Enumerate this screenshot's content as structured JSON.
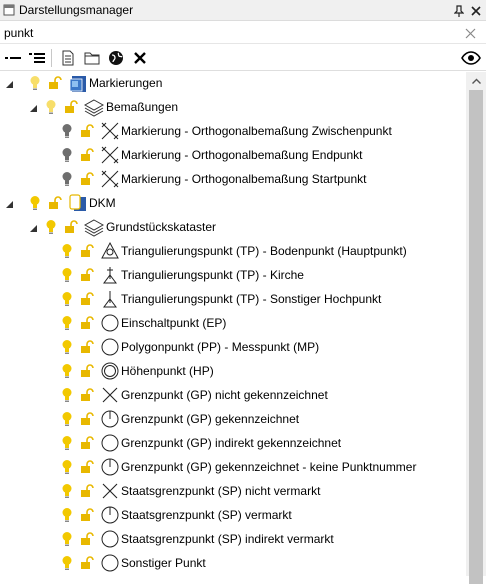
{
  "window": {
    "title": "Darstellungsmanager"
  },
  "search": {
    "value": "punkt"
  },
  "tree": {
    "items": [
      {
        "level": 0,
        "label": "Markierungen",
        "kind": "map",
        "bulb": "light",
        "expanded": true
      },
      {
        "level": 1,
        "label": "Bemaßungen",
        "kind": "layers",
        "bulb": "light",
        "expanded": true
      },
      {
        "level": 2,
        "label": "Markierung - Orthogonalbemaßung Zwischenpunkt",
        "kind": "dim",
        "bulb": "gray"
      },
      {
        "level": 2,
        "label": "Markierung - Orthogonalbemaßung Endpunkt",
        "kind": "dim",
        "bulb": "gray"
      },
      {
        "level": 2,
        "label": "Markierung - Orthogonalbemaßung Startpunkt",
        "kind": "dim",
        "bulb": "gray"
      },
      {
        "level": 0,
        "label": "DKM",
        "kind": "map-dkm",
        "bulb": "yellow",
        "expanded": true
      },
      {
        "level": 1,
        "label": "Grundstückskataster",
        "kind": "layers",
        "bulb": "yellow",
        "expanded": true
      },
      {
        "level": 2,
        "label": "Triangulierungspunkt (TP) - Bodenpunkt (Hauptpunkt)",
        "kind": "triangle-circle",
        "bulb": "yellow"
      },
      {
        "level": 2,
        "label": "Triangulierungspunkt (TP) - Kirche",
        "kind": "triangle-cross",
        "bulb": "yellow"
      },
      {
        "level": 2,
        "label": "Triangulierungspunkt (TP) - Sonstiger Hochpunkt",
        "kind": "triangle-tick",
        "bulb": "yellow"
      },
      {
        "level": 2,
        "label": "Einschaltpunkt (EP)",
        "kind": "circle",
        "bulb": "yellow"
      },
      {
        "level": 2,
        "label": "Polygonpunkt (PP) - Messpunkt (MP)",
        "kind": "circle",
        "bulb": "yellow"
      },
      {
        "level": 2,
        "label": "Höhenpunkt (HP)",
        "kind": "double-circle",
        "bulb": "yellow"
      },
      {
        "level": 2,
        "label": "Grenzpunkt (GP) nicht gekennzeichnet",
        "kind": "x-mark",
        "bulb": "yellow"
      },
      {
        "level": 2,
        "label": "Grenzpunkt (GP) gekennzeichnet",
        "kind": "circle-line",
        "bulb": "yellow"
      },
      {
        "level": 2,
        "label": "Grenzpunkt (GP) indirekt gekennzeichnet",
        "kind": "circle",
        "bulb": "yellow"
      },
      {
        "level": 2,
        "label": "Grenzpunkt (GP) gekennzeichnet - keine Punktnummer",
        "kind": "circle-line",
        "bulb": "yellow"
      },
      {
        "level": 2,
        "label": "Staatsgrenzpunkt (SP) nicht vermarkt",
        "kind": "x-mark",
        "bulb": "yellow"
      },
      {
        "level": 2,
        "label": "Staatsgrenzpunkt (SP) vermarkt",
        "kind": "circle-line",
        "bulb": "yellow"
      },
      {
        "level": 2,
        "label": "Staatsgrenzpunkt (SP) indirekt vermarkt",
        "kind": "circle",
        "bulb": "yellow"
      },
      {
        "level": 2,
        "label": "Sonstiger Punkt",
        "kind": "circle",
        "bulb": "yellow"
      }
    ]
  },
  "colors": {
    "bulb_yellow": "#f2c800",
    "bulb_light": "#f7de6a",
    "bulb_gray": "#6e6e6e",
    "lock": "#e8b800",
    "scroll_thumb": "#c2c2c2"
  },
  "icons": {
    "title": "panel-icon",
    "pin": "pin-icon",
    "close": "close-icon",
    "collapse": "collapse-all-icon",
    "expand": "expand-all-icon",
    "new": "new-document-icon",
    "open": "open-folder-icon",
    "globe": "globe-icon",
    "delete": "delete-icon",
    "eye": "eye-icon",
    "clear": "clear-search-icon"
  }
}
